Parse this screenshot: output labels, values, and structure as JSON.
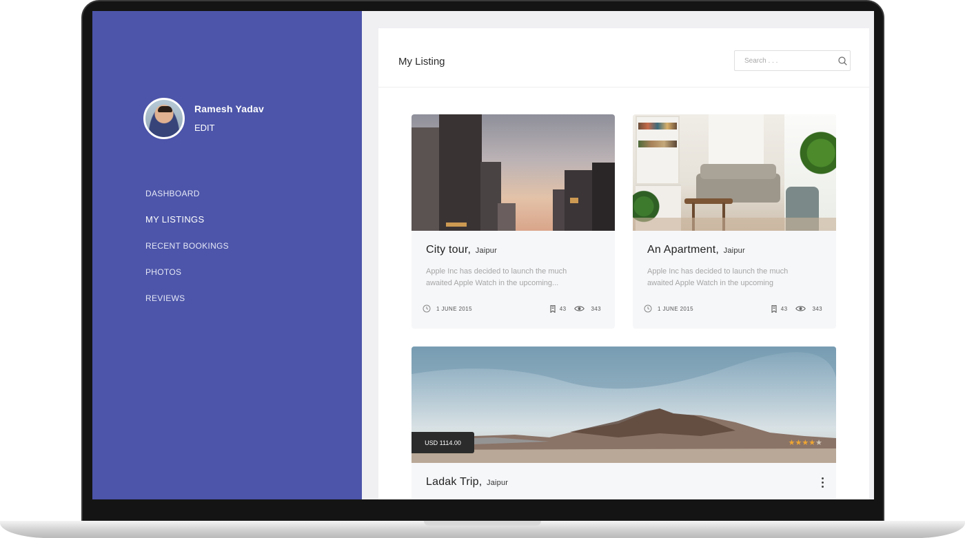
{
  "profile": {
    "name": "Ramesh Yadav",
    "edit_label": "EDIT"
  },
  "nav": {
    "items": [
      {
        "label": "DASHBOARD",
        "active": false
      },
      {
        "label": "MY LISTINGS",
        "active": true
      },
      {
        "label": "RECENT BOOKINGS",
        "active": false
      },
      {
        "label": "PHOTOS",
        "active": false
      },
      {
        "label": "REVIEWS",
        "active": false
      }
    ]
  },
  "header": {
    "title": "My Listing",
    "search_placeholder": "Search . . ."
  },
  "listings": [
    {
      "title": "City tour,",
      "city": "Jaipur",
      "description": "Apple Inc has decided to launch the much awaited Apple Watch in the upcoming...",
      "date": "1 JUNE 2015",
      "bookings": "43",
      "views": "343"
    },
    {
      "title": "An Apartment,",
      "city": "Jaipur",
      "description": "Apple Inc has decided to launch the much awaited Apple Watch in the upcoming",
      "date": "1 JUNE 2015",
      "bookings": "43",
      "views": "343"
    },
    {
      "title": "Ladak Trip,",
      "city": "Jaipur",
      "price": "USD 1114.00",
      "rating": 4,
      "rating_max": 5
    }
  ],
  "colors": {
    "sidebar": "#4c55a9",
    "star": "#f0a732",
    "price_tag": "#2b2b2b"
  }
}
